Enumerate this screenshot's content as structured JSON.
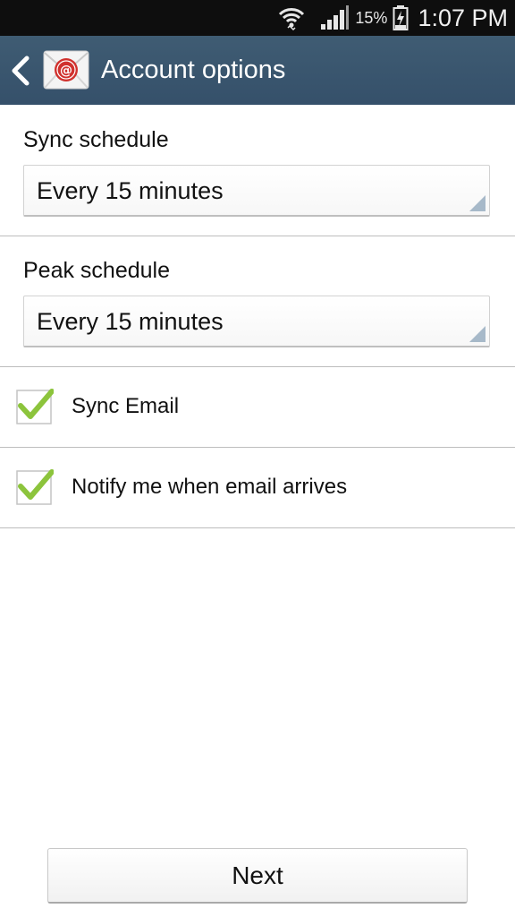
{
  "status_bar": {
    "battery_percent": "15%",
    "time": "1:07 PM",
    "icons": [
      "wifi-icon",
      "signal-icon",
      "battery-charging-icon"
    ]
  },
  "action_bar": {
    "title": "Account options",
    "back_icon": "chevron-left-icon",
    "app_icon": "email-app-icon",
    "color": "#3a566e"
  },
  "sync_schedule": {
    "label": "Sync schedule",
    "value": "Every 15 minutes"
  },
  "peak_schedule": {
    "label": "Peak schedule",
    "value": "Every 15 minutes"
  },
  "options": {
    "sync_email": {
      "label": "Sync Email",
      "checked": true
    },
    "notify": {
      "label": "Notify me when email arrives",
      "checked": true
    },
    "check_color": "#8cc43c"
  },
  "footer": {
    "next_label": "Next"
  }
}
